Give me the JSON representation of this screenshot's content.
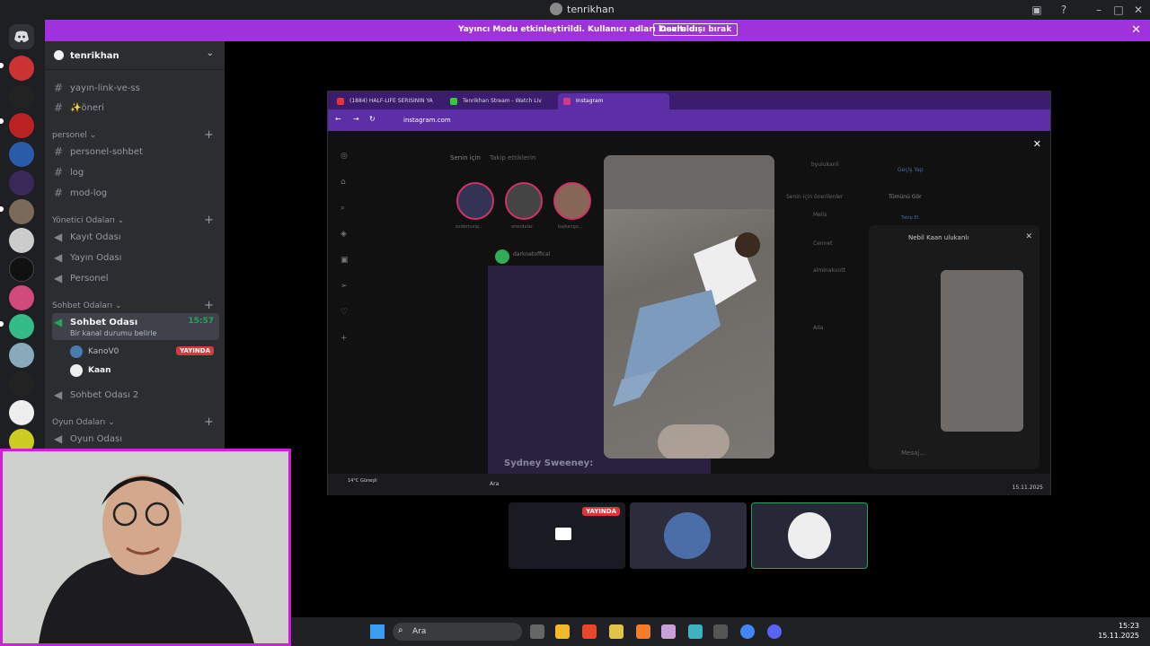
{
  "window": {
    "title": "tenrikhan"
  },
  "banner": {
    "message": "Yayıncı Modu etkinleştirildi. Kullanıcı adları kısaltıldı.",
    "button": "Devre dışı bırak"
  },
  "server": {
    "name": "tenrikhan"
  },
  "channels": {
    "top1": "yayın-link-ve-ss",
    "top2": "✨öneri",
    "cat_personel": "personel",
    "personel_sohbet": "personel-sohbet",
    "log": "log",
    "mod_log": "mod-log",
    "cat_yonetici": "Yönetici Odaları",
    "kayit": "Kayıt Odası",
    "yayin": "Yayın Odası",
    "personel_voice": "Personel",
    "cat_sohbet": "Sohbet Odaları",
    "sohbet": "Sohbet Odası",
    "sohbet_time": "15:57",
    "sohbet_status": "Bir kanal durumu belirle",
    "user1": "KanoV0",
    "user1_badge": "YAYINDA",
    "user2": "Kaan",
    "sohbet2": "Sohbet Odası 2",
    "cat_oyun": "Oyun Odaları",
    "oyun": "Oyun Odası"
  },
  "stream": {
    "tabs": [
      "(1884) HALF-LIFE SERISININ YA",
      "Tenrikhan Stream - Watch Liv",
      "Instagram"
    ],
    "url": "instagram.com",
    "ig_tabs": [
      "Senin için",
      "Takip ettiklerin"
    ],
    "stories": [
      "ozdemunp..",
      "erendalar",
      "bajkango..."
    ],
    "post_user": "darknetoffical",
    "post_caption": "Sydney Sweeney:",
    "profile": "byulukanli",
    "switch": "Geçiş Yap",
    "suggest_title": "Senin için önerilenler",
    "see_all": "Tümünü Gör",
    "suggest": [
      "Melis",
      "Cennet",
      "alminakuntt",
      "Ada"
    ],
    "follow": "Takip Et",
    "dm_name": "Nebil Kaan ulukanlı",
    "dm_input": "Mesaj...",
    "weather": "14°C Güneşli",
    "search": "Ara",
    "date_small": "15.11.2025"
  },
  "thumb_badge": "YAYINDA",
  "taskbar": {
    "search": "Ara",
    "time": "15:23",
    "date": "15.11.2025"
  }
}
